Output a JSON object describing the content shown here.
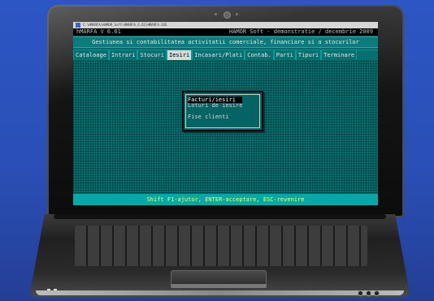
{
  "window": {
    "title": "C:\\HMARFA\\HAMOR_Soft\\HMARFA_6.61\\HMARFA.EXE"
  },
  "app": {
    "version": "hMARFA V 6.61",
    "company": "HAMOR Soft - demonstratie / decembrie 2009",
    "subtitle": "Gestiunea si contabilitatea activitatii comerciale, financiare si a stocurilor"
  },
  "menu": {
    "items": [
      {
        "label": "Cataloage"
      },
      {
        "label": "Intrari"
      },
      {
        "label": "Stocuri"
      },
      {
        "label": "Iesiri"
      },
      {
        "label": "Incasari/Plati"
      },
      {
        "label": "Contab."
      },
      {
        "label": "Parti"
      },
      {
        "label": "Tipuri"
      },
      {
        "label": "Terminare"
      }
    ],
    "active": "Iesiri"
  },
  "popup": {
    "items": [
      {
        "label": "Facturi/iesiri",
        "selected": true
      },
      {
        "label": "Loturi de iesire",
        "selected": false
      },
      {
        "label": "Fise clienti",
        "selected": false
      }
    ]
  },
  "status": {
    "text": "Shift F1-ajutor, ENTER-acceptare, ESC-revenire"
  },
  "colors": {
    "background": "#2a4fb6",
    "screen": "#056b6b",
    "status_text": "#ffff55"
  }
}
